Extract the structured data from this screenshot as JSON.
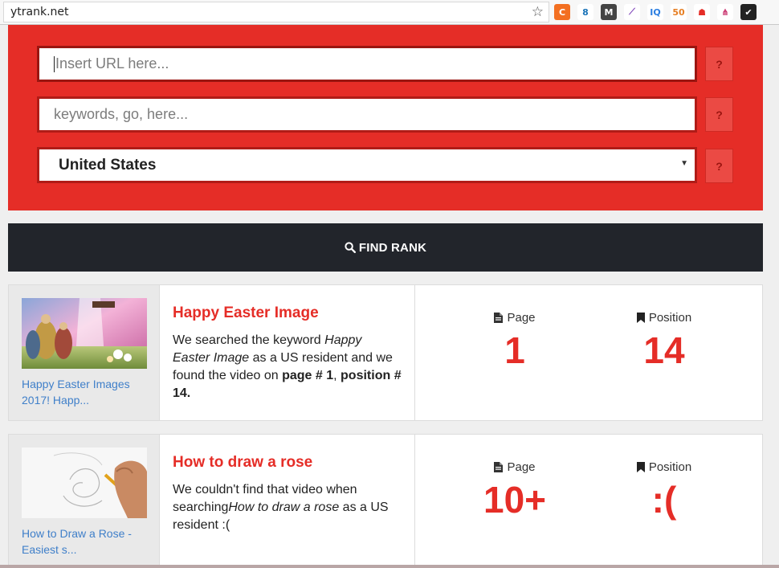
{
  "browser": {
    "url": "ytrank.net",
    "extensions": [
      {
        "name": "c-extension-icon",
        "label": "C",
        "bg": "#f36f21",
        "fg": "#ffffff"
      },
      {
        "name": "person-extension-icon",
        "label": "8",
        "bg": "#ffffff",
        "fg": "#1a73b8"
      },
      {
        "name": "m-extension-icon",
        "label": "M",
        "bg": "#444444",
        "fg": "#ffffff"
      },
      {
        "name": "feather-extension-icon",
        "label": "⟋",
        "bg": "#ffffff",
        "fg": "#7b3fb8"
      },
      {
        "name": "iq-extension-icon",
        "label": "IQ",
        "bg": "#ffffff",
        "fg": "#2a7de1"
      },
      {
        "name": "seo-extension-icon",
        "label": "50",
        "bg": "#ffffff",
        "fg": "#e67e22"
      },
      {
        "name": "red-extension-icon",
        "label": "☗",
        "bg": "#ffffff",
        "fg": "#e52d27"
      },
      {
        "name": "share-extension-icon",
        "label": "⋔",
        "bg": "#ffffff",
        "fg": "#c2185b"
      },
      {
        "name": "check-extension-icon",
        "label": "✔",
        "bg": "#222222",
        "fg": "#ffffff"
      }
    ]
  },
  "form": {
    "url_placeholder": "Insert URL here...",
    "keywords_placeholder": "keywords, go, here...",
    "country_value": "United States",
    "help_label": "?"
  },
  "find_button": {
    "label": "FIND RANK"
  },
  "stat_labels": {
    "page": "Page",
    "position": "Position"
  },
  "results": [
    {
      "thumb_caption": "Happy Easter Images 2017! Happ...",
      "title": "Happy Easter Image",
      "desc_1": "We searched the keyword ",
      "desc_keyword": "Happy Easter Image",
      "desc_2": " as a US resident and we found the video on ",
      "desc_page": "page # 1",
      "desc_sep": ", ",
      "desc_position": "position # 14.",
      "page": "1",
      "position": "14"
    },
    {
      "thumb_caption": "How to Draw a Rose - Easiest s...",
      "title": "How to draw a rose",
      "desc_1": "We couldn't find that video when searching",
      "desc_keyword": "How to draw a rose",
      "desc_2": " as a US resident :(",
      "page": "10+",
      "position": ":("
    }
  ],
  "colors": {
    "brand_red": "#e52d27",
    "dark_button": "#22252b",
    "link_blue": "#3f7fc9"
  }
}
